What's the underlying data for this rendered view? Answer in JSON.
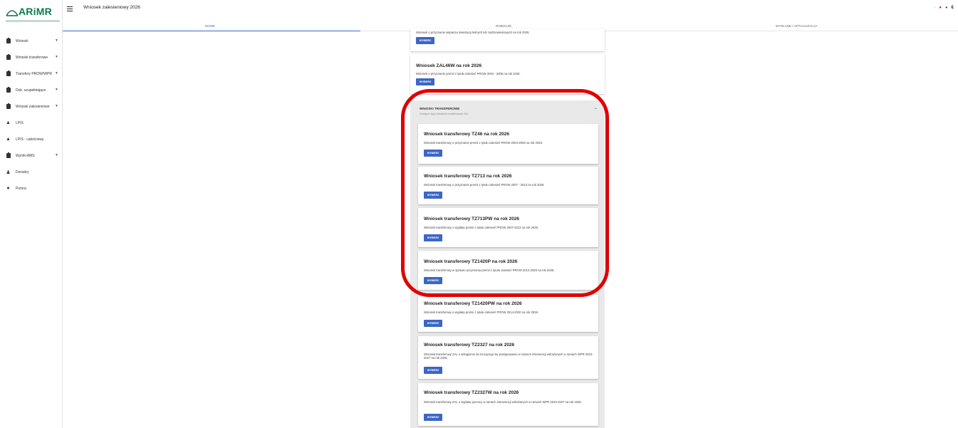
{
  "brand": {
    "logo_text": "ARiMR"
  },
  "header": {
    "title": "Wniosek zalesieniowy 2026"
  },
  "tabs": [
    {
      "label": "NOWE",
      "active": true
    },
    {
      "label": "ROBOCZE",
      "active": false
    },
    {
      "label": "WYSŁANE / AKTUALIZACJA",
      "active": false
    }
  ],
  "sidebar": {
    "items": [
      {
        "label": "Wnioski",
        "icon": "clipboard-icon",
        "expandable": true
      },
      {
        "label": "Wnioski transferowe",
        "icon": "clipboard-icon",
        "expandable": true
      },
      {
        "label": "Transfery PROW/WPR",
        "icon": "clipboard-icon",
        "expandable": true
      },
      {
        "label": "Dok. uzupełniające",
        "icon": "clipboard-icon",
        "expandable": true
      },
      {
        "label": "Wnioski zalesieniowe",
        "icon": "clipboard-icon",
        "expandable": true
      },
      {
        "label": "LPIS",
        "icon": "map-icon",
        "expandable": false
      },
      {
        "label": "LPIS - całościowy",
        "icon": "map-icon",
        "expandable": false
      },
      {
        "label": "Wyniki AMS",
        "icon": "clipboard-icon",
        "expandable": true
      },
      {
        "label": "Doradcy",
        "icon": "person-icon",
        "expandable": false
      },
      {
        "label": "Pomoc",
        "icon": "help-icon",
        "expandable": false
      }
    ]
  },
  "top_cards": [
    {
      "title": "",
      "desc": "Wniosek o przyznanie wsparcia inwestycji leśnych lub zadrzewieniowych na rok 2026.",
      "button": "WYBIERZ"
    },
    {
      "title": "Wniosek ZAL46W na rok 2026",
      "desc": "Wniosek o przyznanie premii z tytułu zalesień PROW 2004 - 2006 na rok 2026.",
      "button": "WYBIERZ"
    }
  ],
  "group": {
    "title": "WNIOSKI TRANSFEROWE",
    "subtitle": "Dostępne typy wniosków transferowych ZAL",
    "cards": [
      {
        "title": "Wniosek transferowy TZ46 na rok 2026",
        "desc": "Wniosek transferowy o przyznanie premii z tytułu zalesień PROW 2004-2006 na rok 2026.",
        "button": "WYBIERZ"
      },
      {
        "title": "Wniosek transferowy TZ713 na rok 2026",
        "desc": "Wniosek transferowy o przyznanie premii z tytułu zalesień PROW 2007 - 2013 na rok 2026.",
        "button": "WYBIERZ"
      },
      {
        "title": "Wniosek transferowy TZ713PW na rok 2026",
        "desc": "Wniosek transferowy o wypłatę premii z tytułu zalesień PROW 2007-2013 na rok 2026.",
        "button": "WYBIERZ"
      },
      {
        "title": "Wniosek transferowy TZ1420P na rok 2026",
        "desc": "Wniosek transferowy w sprawie przyznania premii z tytułu zalesień PROW 2014-2020 na rok 2026.",
        "button": "WYBIERZ"
      },
      {
        "title": "Wniosek transferowy TZ1420PW na rok 2026",
        "desc": "Wniosek transferowy o wypłatę premii z tytułu zalesień PROW 2014-2020 na rok 2026.",
        "button": "WYBIERZ"
      },
      {
        "title": "Wniosek transferowy TZ2327 na rok 2026",
        "desc": "Wniosek transferowy ZAL o wstąpienie do toczącego się postępowania w ramach interwencji wdrażanych w ramach WPR 2023-2027 na rok 2026.",
        "button": "WYBIERZ"
      },
      {
        "title": "Wniosek transferowy TZ2327W na rok 2026",
        "desc": "Wniosek transferowy ZAL o wypłatę pomocy w ramach interwencji wdrażanych w ramach WPR 2023-2027 na rok 2026.",
        "button": "WYBIERZ"
      }
    ]
  },
  "colors": {
    "accent": "#3b66c4",
    "brand": "#0d7a4e",
    "highlight": "#e00000",
    "group_bg": "#e9e9e9"
  }
}
